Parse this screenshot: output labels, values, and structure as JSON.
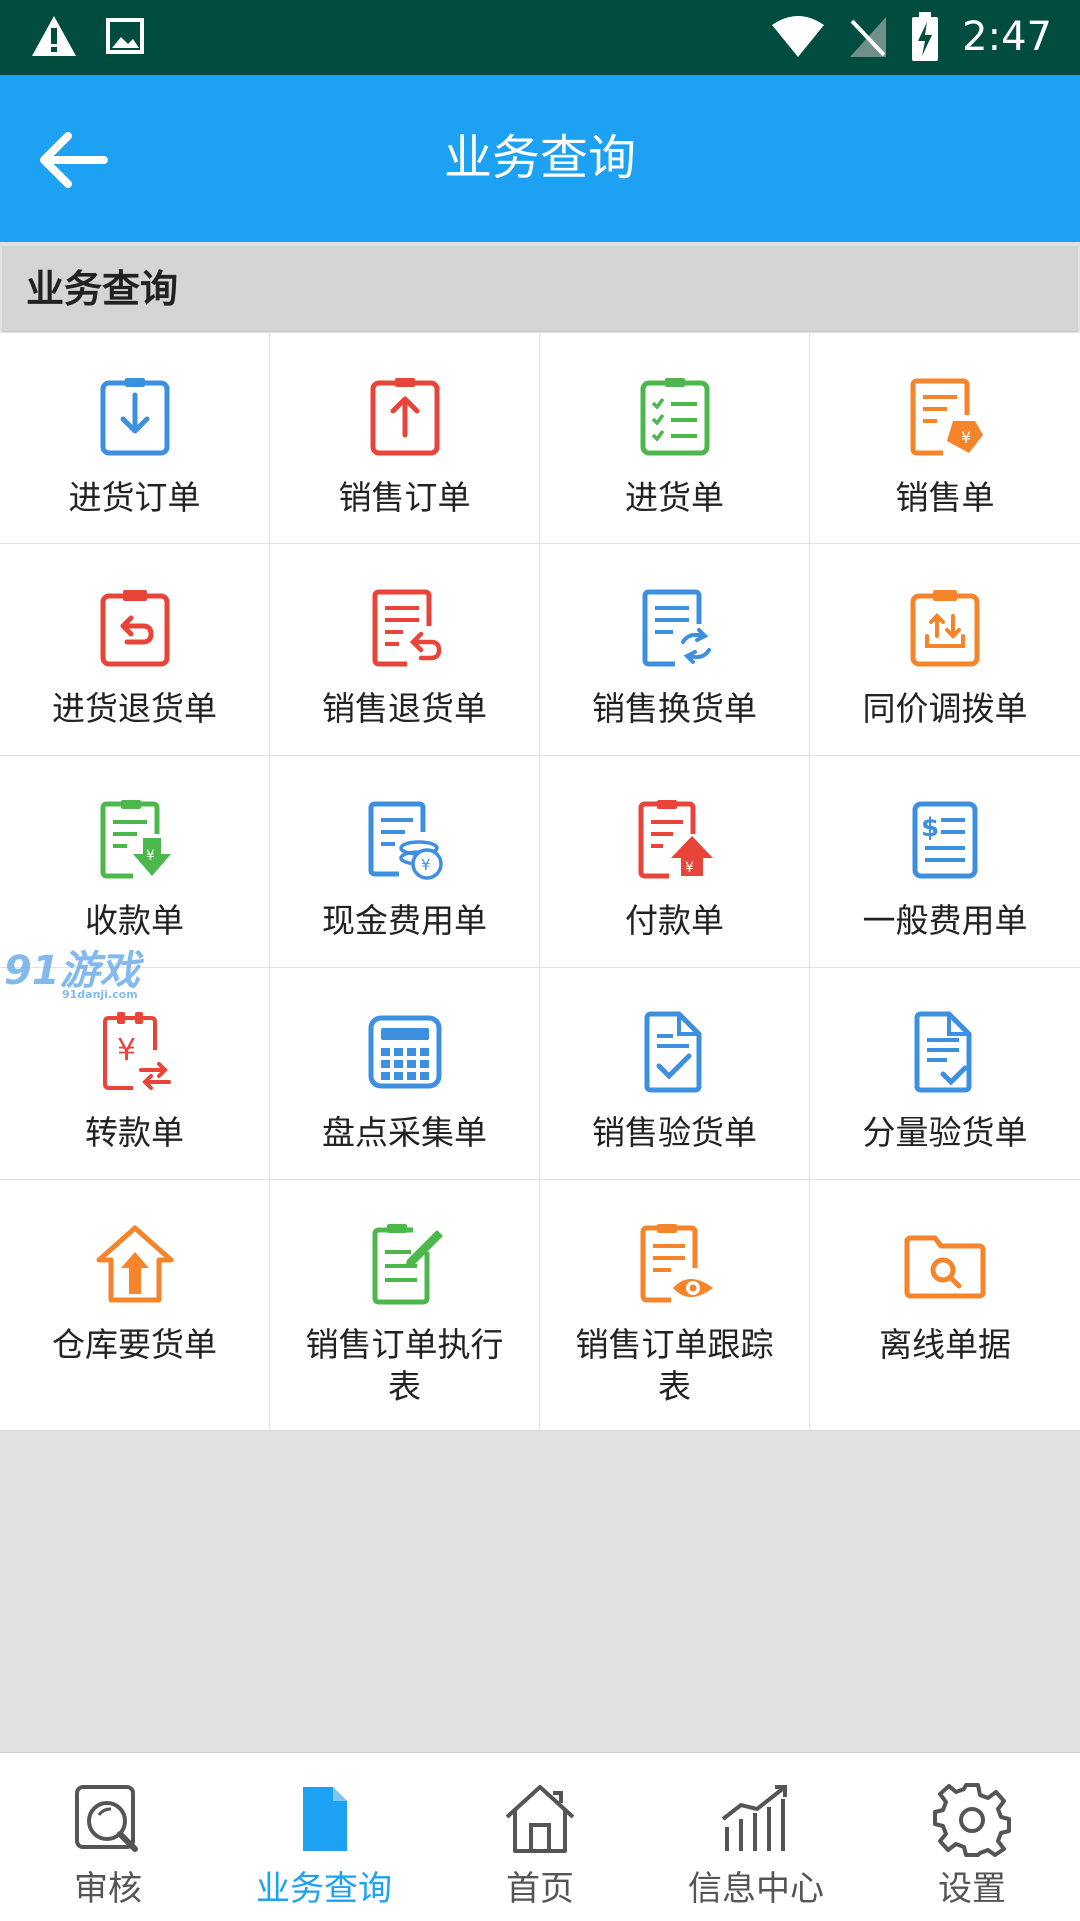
{
  "status_bar": {
    "time": "2:47"
  },
  "app_bar": {
    "title": "业务查询"
  },
  "section": {
    "title": "业务查询"
  },
  "grid": {
    "rows": [
      [
        {
          "label": "进货订单",
          "icon": "download-clipboard-icon",
          "color": "#3d8fe0"
        },
        {
          "label": "销售订单",
          "icon": "upload-clipboard-icon",
          "color": "#e8443a"
        },
        {
          "label": "进货单",
          "icon": "checklist-icon",
          "color": "#4cb84c"
        },
        {
          "label": "销售单",
          "icon": "price-tag-document-icon",
          "color": "#f5842a"
        }
      ],
      [
        {
          "label": "进货退货单",
          "icon": "return-clipboard-icon",
          "color": "#e8443a"
        },
        {
          "label": "销售退货单",
          "icon": "return-document-icon",
          "color": "#e8443a"
        },
        {
          "label": "销售换货单",
          "icon": "exchange-document-icon",
          "color": "#3d8fe0"
        },
        {
          "label": "同价调拨单",
          "icon": "transfer-clipboard-icon",
          "color": "#f5842a"
        }
      ],
      [
        {
          "label": "收款单",
          "icon": "receive-money-icon",
          "color": "#4cb84c"
        },
        {
          "label": "现金费用单",
          "icon": "cash-coins-document-icon",
          "color": "#3d8fe0"
        },
        {
          "label": "付款单",
          "icon": "pay-money-icon",
          "color": "#e8443a"
        },
        {
          "label": "一般费用单",
          "icon": "dollar-document-icon",
          "color": "#3d8fe0"
        }
      ],
      [
        {
          "label": "转款单",
          "icon": "yuan-transfer-icon",
          "color": "#e8443a"
        },
        {
          "label": "盘点采集单",
          "icon": "calculator-icon",
          "color": "#3d8fe0"
        },
        {
          "label": "销售验货单",
          "icon": "check-document-icon",
          "color": "#3d8fe0"
        },
        {
          "label": "分量验货单",
          "icon": "list-check-document-icon",
          "color": "#3d8fe0"
        }
      ],
      [
        {
          "label": "仓库要货单",
          "icon": "house-up-arrow-icon",
          "color": "#f5842a"
        },
        {
          "label": "销售订单执行表",
          "icon": "edit-document-icon",
          "color": "#4cb84c"
        },
        {
          "label": "销售订单跟踪表",
          "icon": "eye-document-icon",
          "color": "#f5842a"
        },
        {
          "label": "离线单据",
          "icon": "folder-search-icon",
          "color": "#f5842a"
        }
      ]
    ]
  },
  "watermark": {
    "text": "91游戏",
    "sub": "91danji.com"
  },
  "bottom_nav": {
    "items": [
      {
        "label": "审核",
        "icon": "audit-search-icon",
        "active": false
      },
      {
        "label": "业务查询",
        "icon": "document-icon",
        "active": true
      },
      {
        "label": "首页",
        "icon": "home-icon",
        "active": false
      },
      {
        "label": "信息中心",
        "icon": "chart-icon",
        "active": false
      },
      {
        "label": "设置",
        "icon": "gear-icon",
        "active": false
      }
    ]
  },
  "colors": {
    "status_bar": "#004d40",
    "app_bar": "#1da1f2",
    "accent": "#1da1f2"
  }
}
